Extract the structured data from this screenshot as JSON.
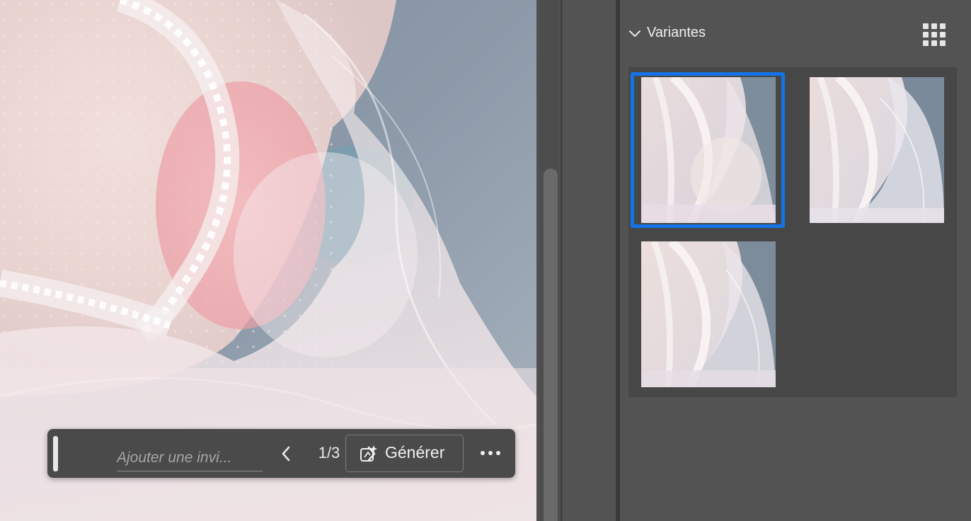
{
  "taskbar": {
    "prompt_placeholder": "Ajouter une invi...",
    "prompt_value": "",
    "counter": "1/3",
    "generate_label": "Générer",
    "prev_icon": "chevron-left-icon",
    "next_icon": "chevron-right-icon",
    "generate_icon": "generative-fill-icon",
    "more_icon": "more-horizontal-icon"
  },
  "variants_panel": {
    "title": "Variantes",
    "collapse_icon": "chevron-down-icon",
    "view_icon": "grid-view-icon",
    "selected_index": 0,
    "variant_count": 3
  },
  "colors": {
    "selection_accent": "#1473e6",
    "panel_background": "#535353",
    "taskbar_background": "#4a4a4a"
  }
}
